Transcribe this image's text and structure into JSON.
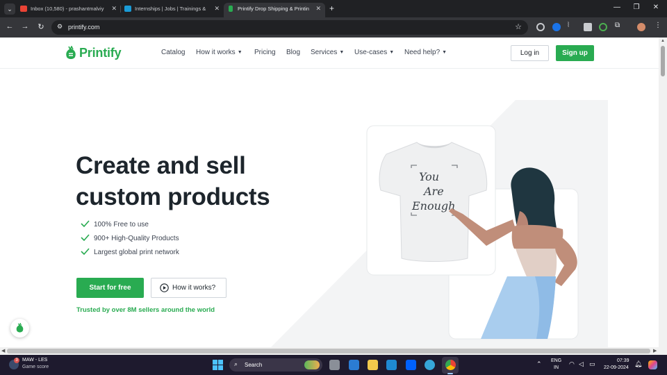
{
  "browser": {
    "tabs": [
      {
        "title": "Inbox (10,580) - prashantmalviy",
        "favicon_color": "#ea4335",
        "active": false
      },
      {
        "title": "Internships | Jobs | Trainings & ",
        "favicon_color": "#1a9bd6",
        "active": false
      },
      {
        "title": "Printify Drop Shipping & Printin",
        "favicon_color": "#29ab51",
        "active": true
      }
    ],
    "new_tab_symbol": "+",
    "url": "printify.com"
  },
  "header": {
    "logo_text": "Printify",
    "nav": [
      {
        "label": "Catalog",
        "dropdown": false
      },
      {
        "label": "How it works",
        "dropdown": true
      },
      {
        "label": "Pricing",
        "dropdown": false
      },
      {
        "label": "Blog",
        "dropdown": false
      },
      {
        "label": "Services",
        "dropdown": true
      },
      {
        "label": "Use-cases",
        "dropdown": true
      },
      {
        "label": "Need help?",
        "dropdown": true
      }
    ],
    "login_label": "Log in",
    "signup_label": "Sign up"
  },
  "hero": {
    "title_line1": "Create and sell",
    "title_line2": "custom products",
    "features": [
      "100% Free to use",
      "900+ High-Quality Products",
      "Largest global print network"
    ],
    "primary_cta": "Start for free",
    "secondary_cta": "How it works?",
    "trusted_text": "Trusted by over 8M sellers around the world",
    "shirt_print": [
      "You",
      "Are",
      "Enough"
    ]
  },
  "taskbar": {
    "widget_title": "MAW - LES",
    "widget_subtitle": "Game score",
    "widget_badge": "3",
    "search_label": "Search",
    "lang_line1": "ENG",
    "lang_line2": "IN",
    "time": "07:39",
    "date": "22-09-2024"
  },
  "colors": {
    "brand_green": "#29ab51",
    "heading": "#1d252c",
    "body_text": "#3c4350",
    "skin": "#c08e7a",
    "hair": "#1f3640",
    "skirt": "#a9cdee"
  }
}
